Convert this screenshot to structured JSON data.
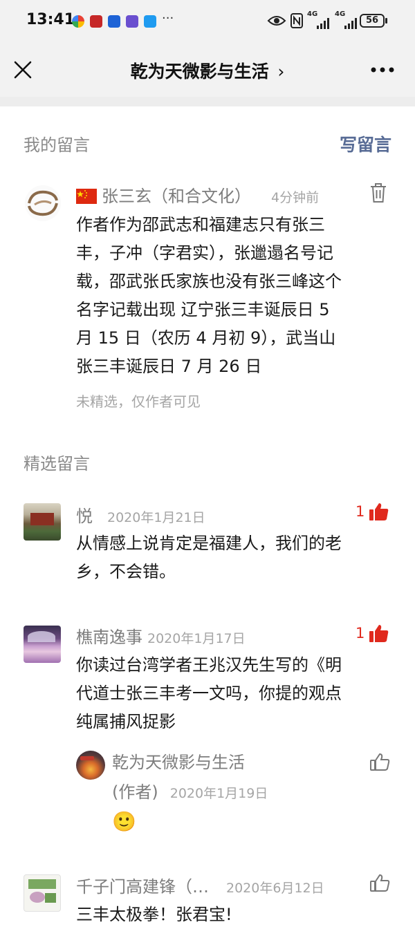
{
  "status": {
    "time": "13:41",
    "more": "···",
    "net1": "4G",
    "net2": "4G",
    "battery": "56"
  },
  "nav": {
    "title": "乾为天微影与生活",
    "title_chevron": "›"
  },
  "my_section": {
    "label": "我的留言",
    "write_label": "写留言"
  },
  "my_comment": {
    "author": "张三玄（和合文化）",
    "time": "4分钟前",
    "lines": [
      "作者作为邵武志和福建志只有张三",
      "丰，子冲（字君实），张邋遢名号记",
      "载，邵武张氏家族也没有张三峰这个",
      "名字记载出现 辽宁张三丰诞辰日 5",
      "月 15 日（农历 4 月初 9），武当山",
      "张三丰诞辰日 7 月 26 日"
    ],
    "note": "未精选，仅作者可见"
  },
  "featured_section": {
    "label": "精选留言"
  },
  "comments": [
    {
      "author": "悦",
      "time": "2020年1月21日",
      "likes": "1",
      "lines": [
        "从情感上说肯定是福建人，我们的老",
        "乡，不会错。"
      ]
    },
    {
      "author": "樵南逸事",
      "time": "2020年1月17日",
      "likes": "1",
      "lines": [
        "你读过台湾学者王兆汉先生写的《明",
        "代道士张三丰考一文吗，你提的观点",
        "纯属捕风捉影"
      ],
      "reply": {
        "author": "乾为天微影与生活",
        "role": "(作者)",
        "time": "2020年1月19日",
        "emoji": "🙂"
      }
    },
    {
      "author": "千子门高建锋（…",
      "time": "2020年6月12日",
      "lines": [
        "三丰太极拳！张君宝!"
      ]
    }
  ],
  "colors": {
    "link": "#576b95",
    "like_red": "#e0291d",
    "meta_gray": "#a5a5a5"
  },
  "icons": [
    "close-icon",
    "more-icon",
    "trash-icon",
    "thumb-up-icon",
    "thumb-up-outline-icon",
    "china-flag-icon"
  ]
}
